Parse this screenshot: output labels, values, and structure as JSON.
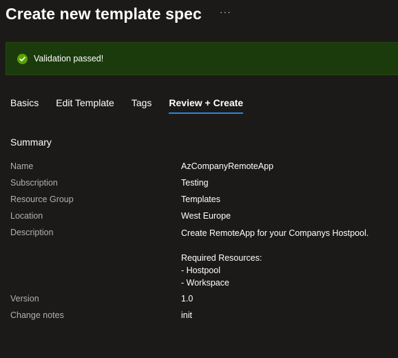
{
  "header": {
    "title": "Create new template spec",
    "more_label": "···"
  },
  "banner": {
    "message": "Validation passed!",
    "icon": "check-circle-icon",
    "color": "#57a300"
  },
  "tabs": [
    {
      "label": "Basics",
      "active": false
    },
    {
      "label": "Edit Template",
      "active": false
    },
    {
      "label": "Tags",
      "active": false
    },
    {
      "label": "Review + Create",
      "active": true
    }
  ],
  "summary": {
    "title": "Summary",
    "rows": [
      {
        "label": "Name",
        "value": "AzCompanyRemoteApp"
      },
      {
        "label": "Subscription",
        "value": "Testing"
      },
      {
        "label": "Resource Group",
        "value": "Templates"
      },
      {
        "label": "Location",
        "value": "West Europe"
      },
      {
        "label": "Description",
        "lines": [
          "Create RemoteApp for your Companys Hostpool.",
          "",
          "Required Resources:",
          "- Hostpool",
          "- Workspace"
        ]
      },
      {
        "label": "Version",
        "value": "1.0"
      },
      {
        "label": "Change notes",
        "value": "init"
      }
    ]
  }
}
